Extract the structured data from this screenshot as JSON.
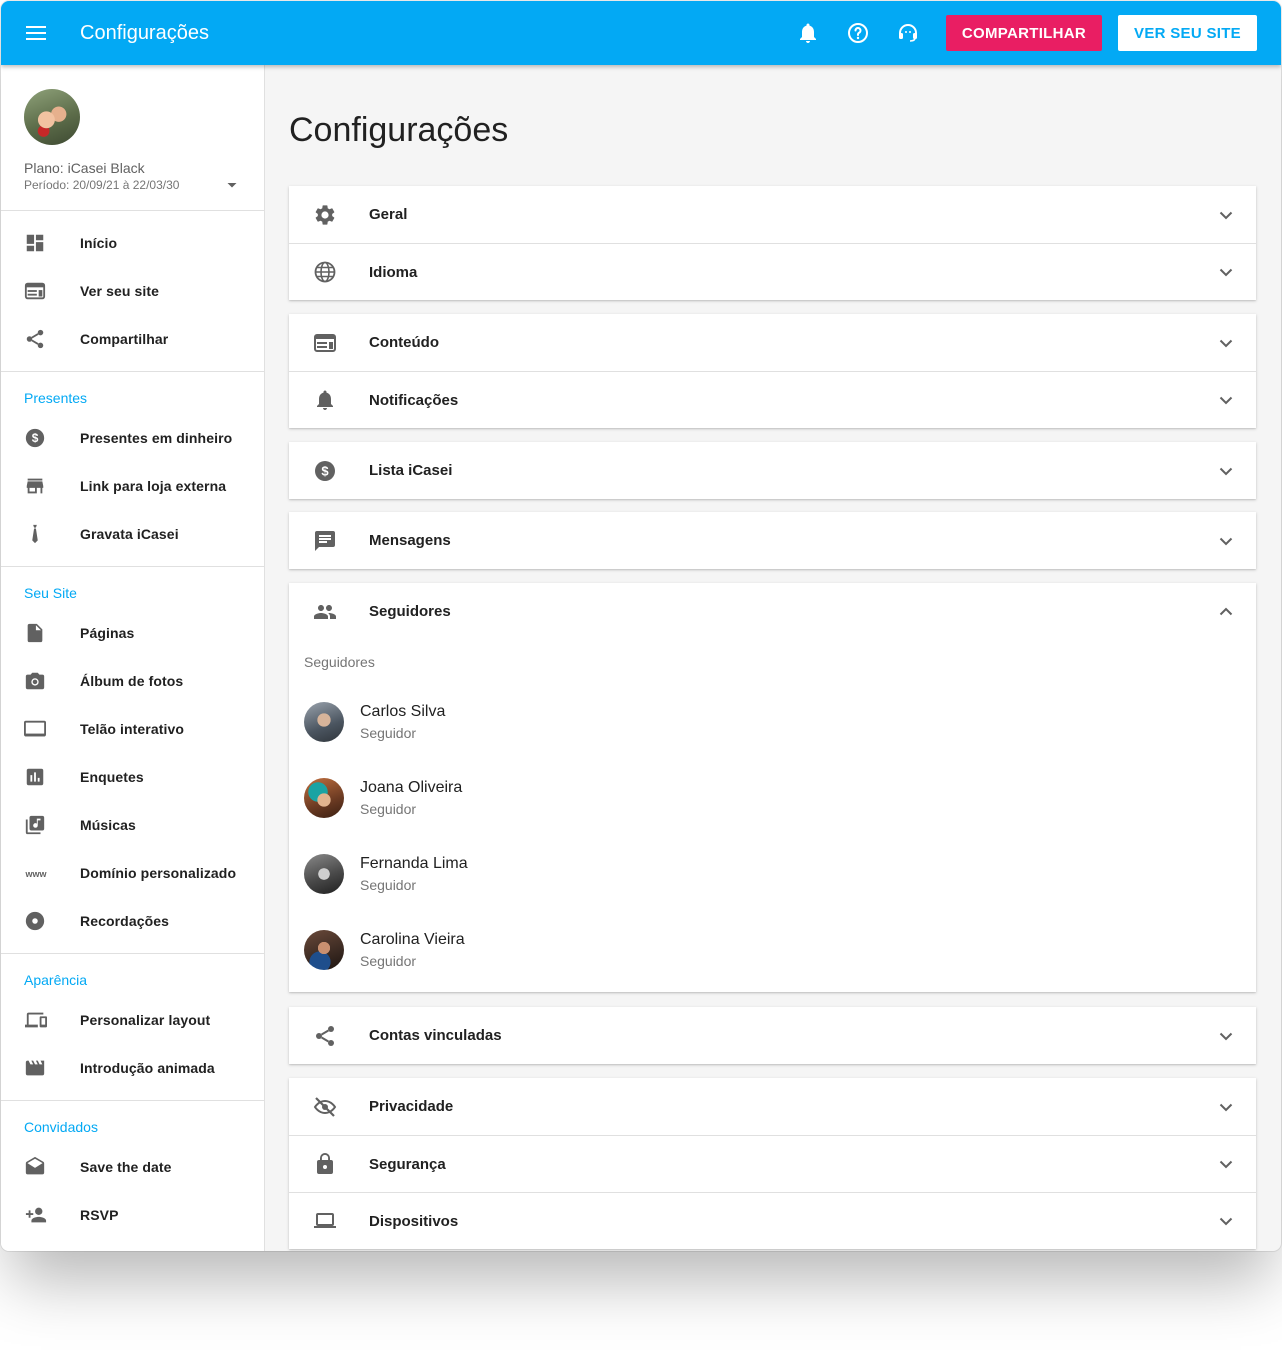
{
  "topbar": {
    "title": "Configurações",
    "share_button": "COMPARTILHAR",
    "site_button": "VER SEU SITE",
    "color": "#03a9f4",
    "share_color": "#e91e63"
  },
  "profile": {
    "plan": "Plano: iCasei Black",
    "period": "Período: 20/09/21 à 22/03/30"
  },
  "sidebar": {
    "main_items": [
      {
        "label": "Início",
        "icon": "dashboard-icon"
      },
      {
        "label": "Ver seu site",
        "icon": "web-icon"
      },
      {
        "label": "Compartilhar",
        "icon": "share-icon"
      }
    ],
    "sections": [
      {
        "title": "Presentes",
        "items": [
          {
            "label": "Presentes em dinheiro",
            "icon": "dollar-circle-icon"
          },
          {
            "label": "Link para loja externa",
            "icon": "store-icon"
          },
          {
            "label": "Gravata iCasei",
            "icon": "tie-icon"
          }
        ]
      },
      {
        "title": "Seu Site",
        "items": [
          {
            "label": "Páginas",
            "icon": "page-icon"
          },
          {
            "label": "Álbum de fotos",
            "icon": "camera-icon"
          },
          {
            "label": "Telão interativo",
            "icon": "monitor-icon"
          },
          {
            "label": "Enquetes",
            "icon": "poll-icon"
          },
          {
            "label": "Músicas",
            "icon": "music-library-icon"
          },
          {
            "label": "Domínio personalizado",
            "icon": "www-icon"
          },
          {
            "label": "Recordações",
            "icon": "disc-icon"
          }
        ]
      },
      {
        "title": "Aparência",
        "items": [
          {
            "label": "Personalizar layout",
            "icon": "devices-icon"
          },
          {
            "label": "Introdução animada",
            "icon": "clapper-icon"
          }
        ]
      },
      {
        "title": "Convidados",
        "items": [
          {
            "label": "Save the date",
            "icon": "envelope-open-icon"
          },
          {
            "label": "RSVP",
            "icon": "person-add-icon"
          }
        ]
      }
    ]
  },
  "main": {
    "title": "Configurações",
    "panels": [
      {
        "rows": [
          {
            "label": "Geral",
            "icon": "gear-icon"
          },
          {
            "label": "Idioma",
            "icon": "globe-icon"
          }
        ]
      },
      {
        "rows": [
          {
            "label": "Conteúdo",
            "icon": "web-icon"
          },
          {
            "label": "Notificações",
            "icon": "bell-icon"
          }
        ]
      },
      {
        "rows": [
          {
            "label": "Lista iCasei",
            "icon": "dollar-circle-icon"
          }
        ]
      },
      {
        "rows": [
          {
            "label": "Mensagens",
            "icon": "message-icon"
          }
        ]
      },
      {
        "rows": [
          {
            "label": "Seguidores",
            "icon": "people-icon",
            "expanded": true
          }
        ]
      },
      {
        "rows": [
          {
            "label": "Contas vinculadas",
            "icon": "share-icon"
          }
        ]
      },
      {
        "rows": [
          {
            "label": "Privacidade",
            "icon": "eye-off-icon"
          },
          {
            "label": "Segurança",
            "icon": "lock-icon"
          },
          {
            "label": "Dispositivos",
            "icon": "laptop-icon"
          }
        ]
      }
    ],
    "followers": {
      "subtitle": "Seguidores",
      "list": [
        {
          "name": "Carlos Silva",
          "role": "Seguidor"
        },
        {
          "name": "Joana Oliveira",
          "role": "Seguidor"
        },
        {
          "name": "Fernanda Lima",
          "role": "Seguidor"
        },
        {
          "name": "Carolina Vieira",
          "role": "Seguidor"
        }
      ]
    }
  }
}
